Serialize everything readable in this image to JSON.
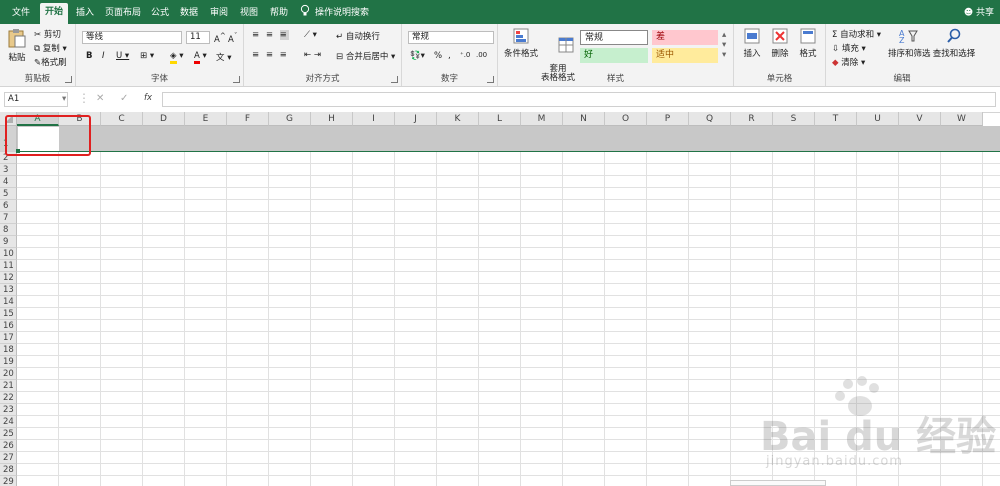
{
  "tabs": [
    "文件",
    "开始",
    "插入",
    "页面布局",
    "公式",
    "数据",
    "审阅",
    "视图",
    "帮助",
    "操作说明搜索"
  ],
  "share_label": "共享",
  "clipboard": {
    "paste": "粘贴",
    "cut": "剪切",
    "copy": "复制",
    "format_painter": "格式刷",
    "label": "剪贴板"
  },
  "font": {
    "name": "等线",
    "size": "11",
    "label": "字体"
  },
  "alignment": {
    "wrap": "自动换行",
    "merge": "合并后居中",
    "label": "对齐方式"
  },
  "number": {
    "format": "常规",
    "label": "数字"
  },
  "styles": {
    "conditional": "条件格式",
    "table": "套用\n表格格式",
    "label": "样式",
    "normal": "常规",
    "bad": "差",
    "good": "好",
    "neutral": "适中"
  },
  "cells": {
    "insert": "插入",
    "delete": "删除",
    "format": "格式",
    "label": "单元格"
  },
  "editing": {
    "autosum": "自动求和",
    "fill": "填充",
    "clear": "清除",
    "sort": "排序和筛选",
    "find": "查找和选择",
    "label": "编辑"
  },
  "formula_bar": {
    "name_box": "A1",
    "fx": "fx",
    "value": ""
  },
  "columns": [
    "A",
    "B",
    "C",
    "D",
    "E",
    "F",
    "G",
    "H",
    "I",
    "J",
    "K",
    "L",
    "M",
    "N",
    "O",
    "P",
    "Q",
    "R",
    "S",
    "T",
    "U",
    "V",
    "W"
  ],
  "rows": [
    "1",
    "2",
    "3",
    "4",
    "5",
    "6",
    "7",
    "8",
    "9",
    "10",
    "11",
    "12",
    "13",
    "14",
    "15",
    "16",
    "17",
    "18",
    "19",
    "20",
    "21",
    "22",
    "23",
    "24",
    "25",
    "26",
    "27",
    "28",
    "29"
  ],
  "watermark": {
    "brand": "Bai du 经验",
    "url": "jingyan.baidu.com"
  },
  "colors": {
    "accent": "#217346",
    "selection": "#c8c8c8",
    "highlight_box": "#e02020"
  }
}
